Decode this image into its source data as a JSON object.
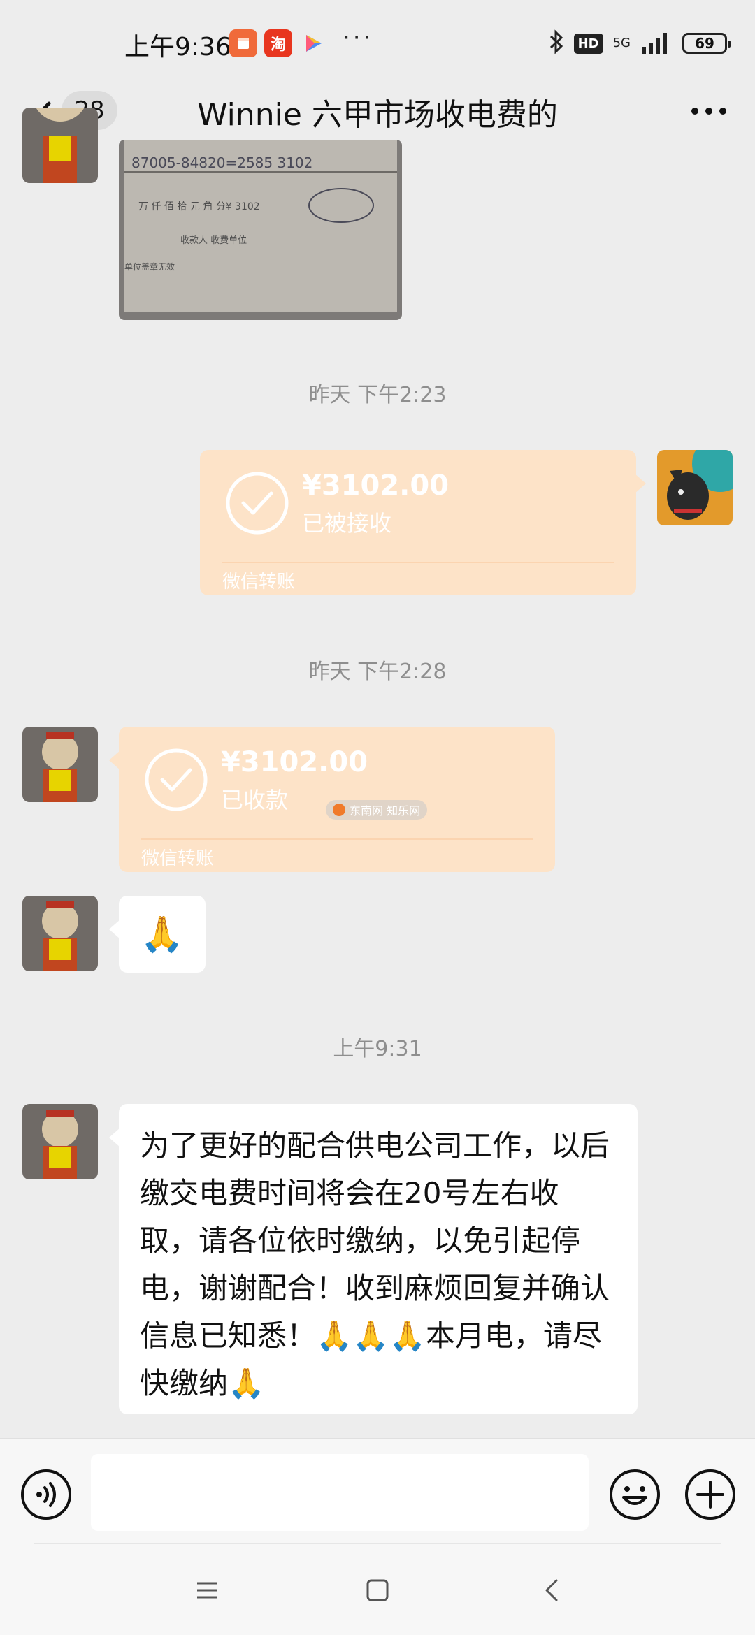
{
  "status_bar": {
    "time": "上午9:36",
    "app_badge_2": "淘",
    "more": "···",
    "hd": "HD",
    "network": "5G",
    "battery": "69"
  },
  "nav": {
    "unread_count": "28",
    "title": "Winnie  六甲市场收电费的"
  },
  "messages": {
    "receipt_photo": {
      "line1": "87005-84820=2585 3102",
      "line2": "万 仟 佰 拾 元 角 分¥ 3102",
      "line3": "收款人        收费单位",
      "line4": "单位盖章无效"
    },
    "ts1": "昨天 下午2:23",
    "transfer_self": {
      "amount": "¥3102.00",
      "status": "已被接收",
      "footer": "微信转账"
    },
    "ts2": "昨天 下午2:28",
    "transfer_peer": {
      "amount": "¥3102.00",
      "status": "已收款",
      "footer": "微信转账"
    },
    "watermark": "东南网  知乐网",
    "emoji_reply": "🙏",
    "ts3": "上午9:31",
    "announcement": "为了更好的配合供电公司工作，以后缴交电费时间将会在20号左右收取，请各位依时缴纳，以免引起停电，谢谢配合！收到麻烦回复并确认信息已知悉！🙏🙏🙏本月电，请尽快缴纳🙏"
  },
  "input": {
    "value": ""
  },
  "colors": {
    "background": "#ededed",
    "transfer_card": "#fde3c8",
    "bubble": "#ffffff",
    "timestamp_text": "#8e8e8e"
  }
}
